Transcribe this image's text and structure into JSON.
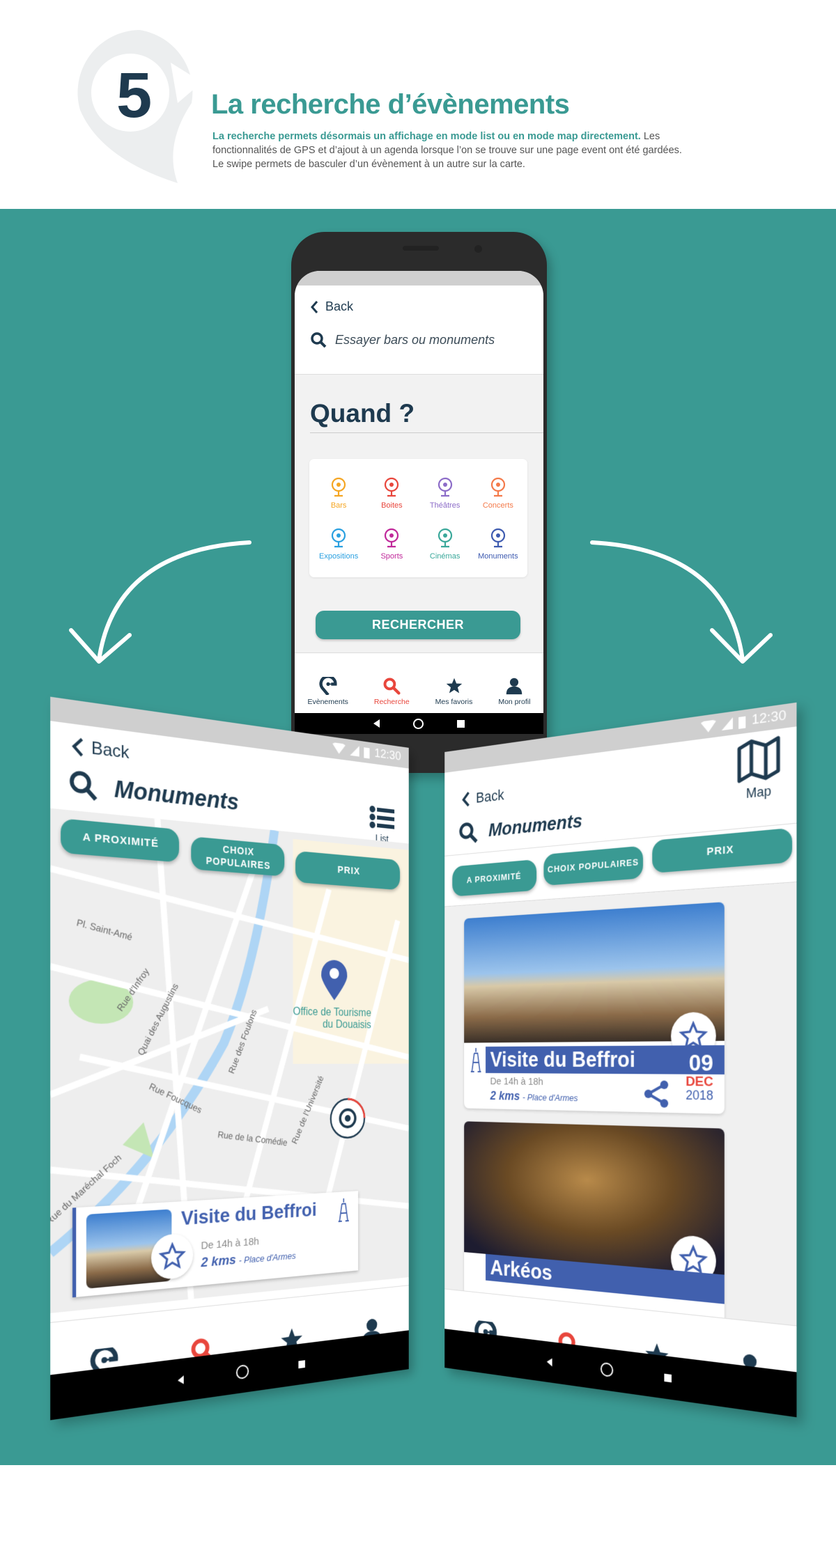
{
  "header": {
    "step_number": "5",
    "title": "La recherche d’évènements",
    "intro_highlight": "La recherche permets désormais un affichage en mode list ou en mode map directement.",
    "intro_rest": " Les fonctionnalités de GPS et d’ajout à un agenda lorsque l’on se trouve sur une page event ont été gardées.",
    "intro_line2": "Le swipe permets de basculer d’un évènement à un autre sur la carte."
  },
  "colors": {
    "teal": "#3a9a93",
    "navy": "#1e3a4f",
    "blue": "#4160ae",
    "red": "#e8463c"
  },
  "nav": {
    "items": [
      {
        "label": "Evènements",
        "icon": "pin-g-icon"
      },
      {
        "label": "Recherche",
        "icon": "search-icon",
        "active": true
      },
      {
        "label": "Mes favoris",
        "icon": "star-icon"
      },
      {
        "label": "Mon profil",
        "icon": "user-icon"
      }
    ]
  },
  "search_screen": {
    "back": "Back",
    "search_placeholder": "Essayer bars ou monuments",
    "when_label": "Quand ?",
    "categories": [
      {
        "label": "Bars",
        "color": "#f5a623",
        "icon": "bar-stool-icon"
      },
      {
        "label": "Boites",
        "color": "#e8463c",
        "icon": "vinyl-icon"
      },
      {
        "label": "Théâtres",
        "color": "#8c6cc8",
        "icon": "masks-icon"
      },
      {
        "label": "Concerts",
        "color": "#f47a4a",
        "icon": "microphone-icon"
      },
      {
        "label": "Expositions",
        "color": "#2aa0e0",
        "icon": "easel-icon"
      },
      {
        "label": "Sports",
        "color": "#c0289a",
        "icon": "trophy-icon"
      },
      {
        "label": "Cinémas",
        "color": "#3aa89a",
        "icon": "camera-icon"
      },
      {
        "label": "Monuments",
        "color": "#3e5bb0",
        "icon": "eiffel-tower-icon"
      }
    ],
    "search_button": "RECHERCHER"
  },
  "map_screen": {
    "status_time": "12:30",
    "back": "Back",
    "query": "Monuments",
    "toggle_label": "List",
    "filters": [
      "A PROXIMITÉ",
      "CHOIX POPULAIRES",
      "PRIX"
    ],
    "map_labels": [
      "Pl. Saint-Amé",
      "Rue d'Infroy",
      "Quai des Augustins",
      "Rue Foucques",
      "Rue des Foulons",
      "Rue de la Comédie",
      "Rue de l'Université",
      "Rue du Maréchal Foch",
      "Office de Tourisme",
      "du Douaisis"
    ],
    "event": {
      "title": "Visite du Beffroi",
      "hours": "De 14h à 18h",
      "distance": "2 kms",
      "place": "- Place d'Armes"
    }
  },
  "list_screen": {
    "status_time": "12:30",
    "back": "Back",
    "query": "Monuments",
    "toggle_label": "Map",
    "filters": [
      "A PROXIMITÉ",
      "CHOIX POPULAIRES",
      "PRIX"
    ],
    "events": [
      {
        "title": "Visite du Beffroi",
        "hours": "De 14h à 18h",
        "distance": "2 kms",
        "place": "- Place d'Armes",
        "day": "09",
        "month": "DEC",
        "year": "2018"
      },
      {
        "title": "Arkéos"
      }
    ]
  }
}
